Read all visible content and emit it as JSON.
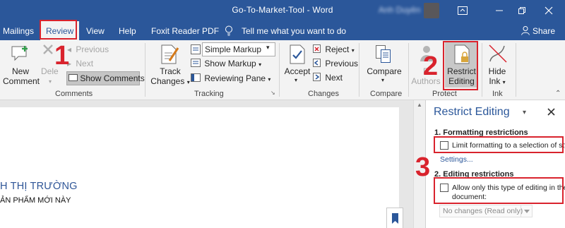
{
  "window": {
    "title": "Go-To-Market-Tool  -  Word",
    "user": "Anh Duyên"
  },
  "tabs": {
    "mailings": "Mailings",
    "review": "Review",
    "view": "View",
    "help": "Help",
    "foxit": "Foxit Reader PDF",
    "tell_me": "Tell me what you want to do",
    "share": "Share"
  },
  "ribbon": {
    "comments": {
      "new_comment": [
        "New",
        "Comment"
      ],
      "delete": "Dele",
      "previous": "Previous",
      "next": "Next",
      "show_comments": "Show Comments",
      "group_label": "Comments"
    },
    "tracking": {
      "track_changes": [
        "Track",
        "Changes"
      ],
      "markup_select": "Simple Markup",
      "show_markup": "Show Markup",
      "reviewing_pane": "Reviewing Pane",
      "group_label": "Tracking"
    },
    "changes": {
      "accept": "Accept",
      "reject": "Reject",
      "previous": "Previous",
      "next": "Next",
      "group_label": "Changes"
    },
    "compare": {
      "compare": "Compare",
      "group_label": "Compare"
    },
    "protect": {
      "block_authors": [
        "B",
        "Authors"
      ],
      "restrict_editing": [
        "Restrict",
        "Editing"
      ],
      "group_label": "Protect"
    },
    "ink": {
      "hide_ink": [
        "Hide",
        "Ink"
      ],
      "group_label": "Ink"
    }
  },
  "steps": [
    "1",
    "2",
    "3"
  ],
  "document": {
    "heading": "H THỊ TRƯỜNG",
    "text": "ẢN PHẨM MỚI NÀY"
  },
  "restrict_pane": {
    "title": "Restrict Editing",
    "formatting_heading": "1. Formatting restrictions",
    "limit_formatting": "Limit formatting to a selection of style",
    "settings_link": "Settings...",
    "editing_heading": "2. Editing restrictions",
    "allow_editing": [
      "Allow only this type of editing in the",
      "document:"
    ],
    "editing_type": "No changes (Read only)"
  },
  "colors": {
    "brand": "#2b579a",
    "annotation": "#d9232d"
  }
}
